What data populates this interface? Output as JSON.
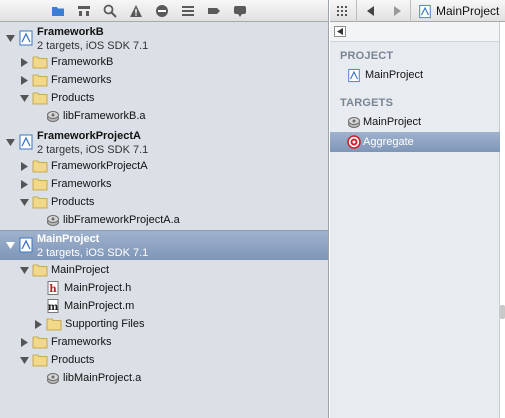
{
  "navigator": {
    "toolbar_icons": [
      "folder-icon",
      "hierarchy-icon",
      "search-icon",
      "warning-icon",
      "breakpoint-diamond-icon",
      "list-icon",
      "tag-icon",
      "speech-bubble-icon"
    ],
    "projects": [
      {
        "name": "FrameworkB",
        "subtitle": "2 targets, iOS SDK 7.1",
        "children": [
          {
            "label": "FrameworkB",
            "type": "folder",
            "disclosure": "collapsed"
          },
          {
            "label": "Frameworks",
            "type": "folder",
            "disclosure": "collapsed"
          },
          {
            "label": "Products",
            "type": "folder",
            "disclosure": "expanded"
          },
          {
            "label": "libFrameworkB.a",
            "type": "library"
          }
        ]
      },
      {
        "name": "FrameworkProjectA",
        "subtitle": "2 targets, iOS SDK 7.1",
        "children": [
          {
            "label": "FrameworkProjectA",
            "type": "folder",
            "disclosure": "collapsed"
          },
          {
            "label": "Frameworks",
            "type": "folder",
            "disclosure": "collapsed"
          },
          {
            "label": "Products",
            "type": "folder",
            "disclosure": "expanded"
          },
          {
            "label": "libFrameworkProjectA.a",
            "type": "library"
          }
        ]
      },
      {
        "name": "MainProject",
        "subtitle": "2 targets, iOS SDK 7.1",
        "children": [
          {
            "label": "MainProject",
            "type": "folder",
            "disclosure": "expanded"
          },
          {
            "label": "MainProject.h",
            "type": "header-file"
          },
          {
            "label": "MainProject.m",
            "type": "source-file"
          },
          {
            "label": "Supporting Files",
            "type": "folder",
            "disclosure": "collapsed"
          },
          {
            "label": "Frameworks",
            "type": "folder",
            "disclosure": "collapsed"
          },
          {
            "label": "Products",
            "type": "folder",
            "disclosure": "expanded"
          },
          {
            "label": "libMainProject.a",
            "type": "library"
          }
        ]
      }
    ]
  },
  "jump_bar": {
    "crumb": "MainProject"
  },
  "target_list": {
    "project_header": "PROJECT",
    "project_item": "MainProject",
    "targets_header": "TARGETS",
    "targets": [
      {
        "label": "MainProject",
        "icon": "library-target-icon",
        "selected": false
      },
      {
        "label": "Aggregate",
        "icon": "aggregate-target-icon",
        "selected": true
      }
    ]
  },
  "colors": {
    "navigator_bg": "#dbe0e6",
    "selection": "#8aa0c0",
    "folder": "#f2d889",
    "section_header": "#7a8594",
    "aggregate_red": "#d0202a"
  }
}
